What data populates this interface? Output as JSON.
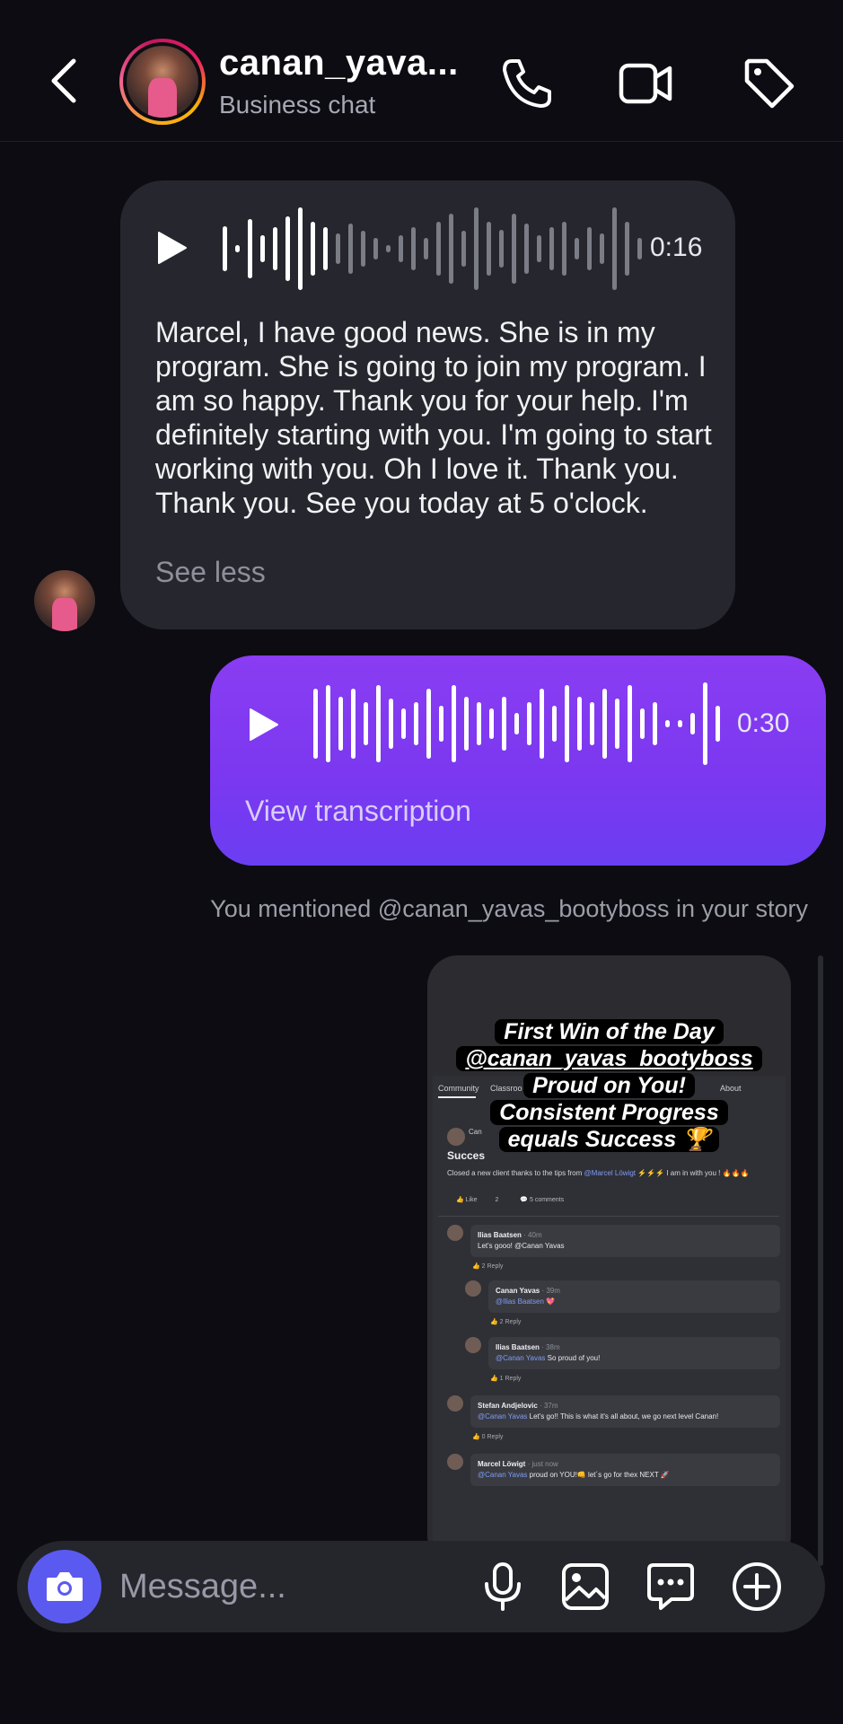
{
  "header": {
    "title": "canan_yava...",
    "subtitle": "Business chat",
    "icons": [
      "back-chevron-icon",
      "phone-icon",
      "video-camera-icon",
      "tag-icon"
    ]
  },
  "messages": {
    "incoming_voice": {
      "duration": "0:16",
      "transcript": "Marcel, I have good news. She is in my program. She is going to join my program. I am so happy. Thank you for your help. I'm definitely starting with you. I'm going to start working with you. Oh I love it. Thank you. Thank you. See you today at 5 o'clock.",
      "toggle_label": "See less",
      "played_fraction": 0.25
    },
    "outgoing_voice": {
      "duration": "0:30",
      "transcription_label": "View transcription"
    },
    "mention_notice": "You mentioned @canan_yavas_bootyboss in your story",
    "story": {
      "caption_lines": [
        "First Win of the Day",
        "@canan_yavas_bootyboss",
        "Proud on You!",
        "Consistent Progress",
        "equals Success 🏆"
      ],
      "tabs": [
        "Community",
        "Classroo",
        "About"
      ],
      "post_author": "Can",
      "post_title": "Succes",
      "post_body_prefix": "Closed a new client thanks to the tips from ",
      "post_body_mention": "@Marcel Löwigt",
      "post_body_suffix": " ⚡⚡⚡ I am in with you ! 🔥🔥🔥",
      "like_label": "Like",
      "like_count": "2",
      "comments_label": "5 comments",
      "comments": [
        {
          "name": "Ilias Baatsen",
          "time": "· 40m",
          "mention": "",
          "text": "Let's gooo! @Canan Yavas",
          "likes": "2",
          "reply": "Reply"
        },
        {
          "name": "Canan Yavas",
          "time": "· 39m",
          "mention": "@Ilias Baatsen",
          "text": " 💖",
          "likes": "2",
          "reply": "Reply"
        },
        {
          "name": "Ilias Baatsen",
          "time": "· 38m",
          "mention": "@Canan Yavas",
          "text": " So proud of you!",
          "likes": "1",
          "reply": "Reply"
        },
        {
          "name": "Stefan Andjelovic",
          "time": "· 37m",
          "mention": "@Canan Yavas",
          "text": " Let's go!! This is what it's all about, we go next level Canan!",
          "likes": "0",
          "reply": "Reply"
        },
        {
          "name": "Marcel Löwigt",
          "time": "· just now",
          "mention": "@Canan Yavas",
          "text": " proud on YOU!👊 let´s go for thex NEXT 🚀",
          "likes": "",
          "reply": ""
        }
      ]
    }
  },
  "composer": {
    "placeholder": "Message...",
    "icons": [
      "camera-icon",
      "microphone-icon",
      "gallery-icon",
      "sticker-chat-icon",
      "plus-circle-icon"
    ]
  },
  "colors": {
    "background": "#0c0c12",
    "incoming_bubble": "#26272e",
    "outgoing_bubble": "#7a38f0",
    "camera_button": "#5b5af0"
  }
}
